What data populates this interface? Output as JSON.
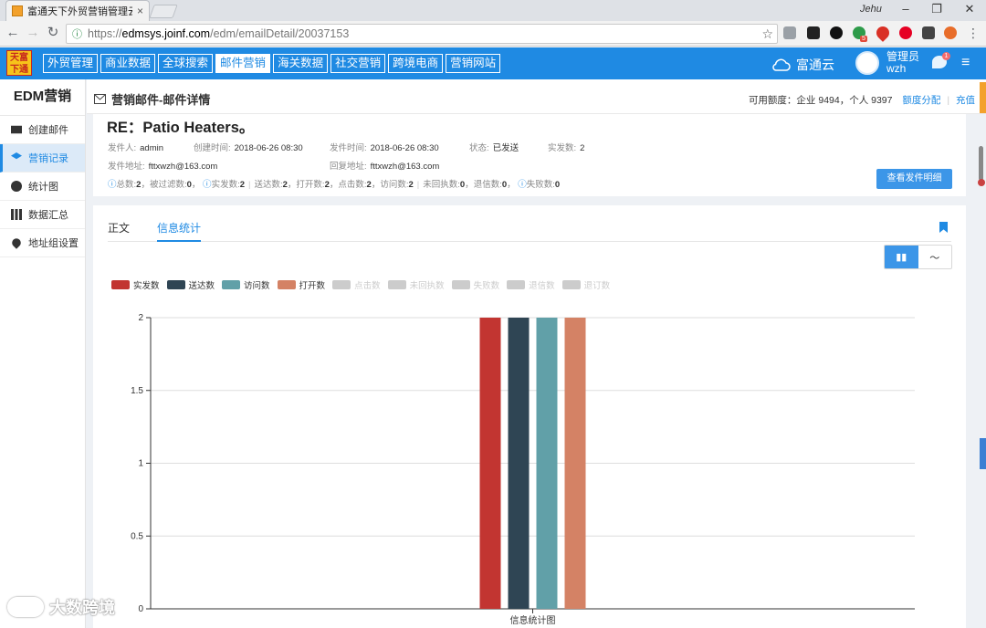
{
  "browser": {
    "tab_title": "富通天下外贸营销管理云",
    "tab_close": "×",
    "profile": "Jehu",
    "url_prefix": "https://",
    "url_host": "edmsys.joinf.com",
    "url_path": "/edm/emailDetail/20037153",
    "ext_badge": "5"
  },
  "topnav": {
    "logo_text": "天富下通",
    "items": [
      "外贸管理",
      "商业数据",
      "全球搜索",
      "邮件营销",
      "海关数据",
      "社交营销",
      "跨境电商",
      "营销网站"
    ],
    "active_index": 3,
    "cloud_label": "富通云",
    "user_role": "管理员",
    "user_name": "wzh",
    "msg_badge": "1"
  },
  "sidebar": {
    "title": "EDM营销",
    "items": [
      {
        "label": "创建邮件",
        "icon": "mail-icon"
      },
      {
        "label": "营销记录",
        "icon": "layers-icon"
      },
      {
        "label": "统计图",
        "icon": "pie-chart-icon"
      },
      {
        "label": "数据汇总",
        "icon": "bar-chart-icon"
      },
      {
        "label": "地址组设置",
        "icon": "location-pin-icon"
      }
    ],
    "active_index": 1
  },
  "header": {
    "title": "营销邮件-邮件详情",
    "quota_label": "可用额度：企业 9494，个人 9397",
    "quota_link": "额度分配",
    "recharge_link": "充值"
  },
  "detail": {
    "subject": "RE：Patio Heaters。",
    "sender_label": "发件人:",
    "sender": "admin",
    "created_label": "创建时间:",
    "created": "2018-06-26 08:30",
    "sent_label": "发件时间:",
    "sent": "2018-06-26 08:30",
    "status_label": "状态:",
    "status": "已发送",
    "actual_label": "实发数:",
    "actual": "2",
    "from_label": "发件地址:",
    "from": "fttxwzh@163.com",
    "reply_label": "回复地址:",
    "reply": "fttxwzh@163.com",
    "stats": {
      "total_label": "总数:",
      "total": "2",
      "filtered_label": "被过滤数:",
      "filtered": "0",
      "actual_label": "实发数:",
      "actual": "2",
      "delivered_label": "送达数:",
      "delivered": "2",
      "opened_label": "打开数:",
      "opened": "2",
      "clicked_label": "点击数:",
      "clicked": "2",
      "visited_label": "访问数:",
      "visited": "2",
      "unexecuted_label": "未回执数:",
      "unexecuted": "0",
      "bounced_label": "退信数:",
      "bounced": "0",
      "failed_label": "失败数:",
      "failed": "0"
    },
    "detail_button": "查看发件明细"
  },
  "content_tabs": [
    "正文",
    "信息统计"
  ],
  "content_active_index": 1,
  "legend": [
    {
      "name": "实发数",
      "color": "#c23531",
      "active": true
    },
    {
      "name": "送达数",
      "color": "#2f4554",
      "active": true
    },
    {
      "name": "访问数",
      "color": "#61a0a8",
      "active": true
    },
    {
      "name": "打开数",
      "color": "#d48265",
      "active": true
    },
    {
      "name": "点击数",
      "color": "#cccccc",
      "active": false
    },
    {
      "name": "未回执数",
      "color": "#cccccc",
      "active": false
    },
    {
      "name": "失败数",
      "color": "#cccccc",
      "active": false
    },
    {
      "name": "退信数",
      "color": "#cccccc",
      "active": false
    },
    {
      "name": "退订数",
      "color": "#cccccc",
      "active": false
    }
  ],
  "chart_data": {
    "type": "bar",
    "categories": [
      "信息统计图"
    ],
    "series": [
      {
        "name": "实发数",
        "values": [
          2
        ],
        "color": "#c23531"
      },
      {
        "name": "送达数",
        "values": [
          2
        ],
        "color": "#2f4554"
      },
      {
        "name": "访问数",
        "values": [
          2
        ],
        "color": "#61a0a8"
      },
      {
        "name": "打开数",
        "values": [
          2
        ],
        "color": "#d48265"
      }
    ],
    "yticks": [
      "0",
      "0.5",
      "1",
      "1.5",
      "2"
    ],
    "ylim": [
      0,
      2
    ],
    "grid": true,
    "legend_position": "top-left"
  },
  "watermark": "大数跨境"
}
